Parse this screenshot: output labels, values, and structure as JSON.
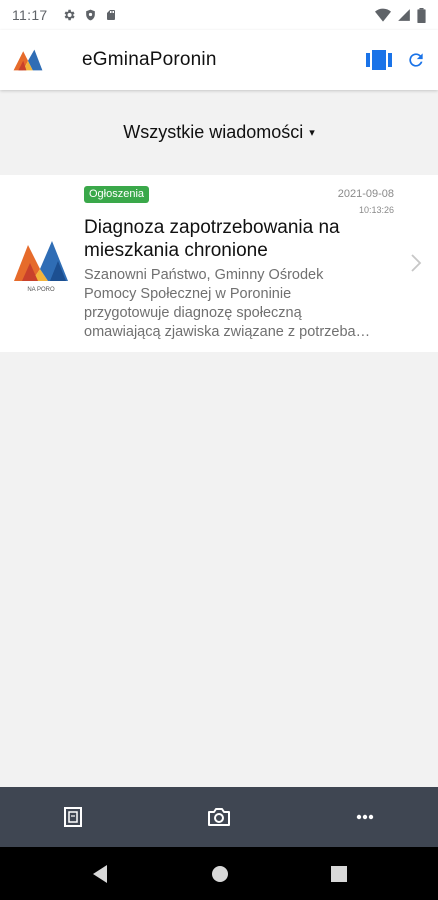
{
  "status_bar": {
    "time": "11:17",
    "left_icons": [
      "gear-icon",
      "shield-icon",
      "sd-card-icon"
    ],
    "right_icons": [
      "wifi-icon",
      "signal-icon",
      "battery-icon"
    ]
  },
  "app_bar": {
    "title": "eGminaPoronin",
    "logo": "gmina-logo",
    "actions": [
      "card-view-icon",
      "refresh-icon"
    ],
    "accent_color": "#1a73e8"
  },
  "filter": {
    "label": "Wszystkie wiadomości",
    "caret": "▾"
  },
  "messages": [
    {
      "category": "Ogłoszenia",
      "category_color": "#3aa84a",
      "date": "2021-09-08",
      "time": "10:13:26",
      "title": "Diagnoza zapotrzebowania na mieszkania chronione",
      "excerpt_lines": [
        "Szanowni Państwo, Gminny Ośrodek",
        "Pomocy Społecznej w Poroninie",
        "przygotowuje diagnozę społeczną",
        "omawiającą zjawiska związane z potrzeba…"
      ],
      "avatar_caption": "NA PORO"
    }
  ],
  "bottom_toolbar": {
    "items": [
      "document-icon",
      "camera-icon",
      "more-icon"
    ],
    "background": "#3f4652"
  },
  "nav_bar": {
    "items": [
      "back-icon",
      "home-icon",
      "recents-icon"
    ]
  }
}
